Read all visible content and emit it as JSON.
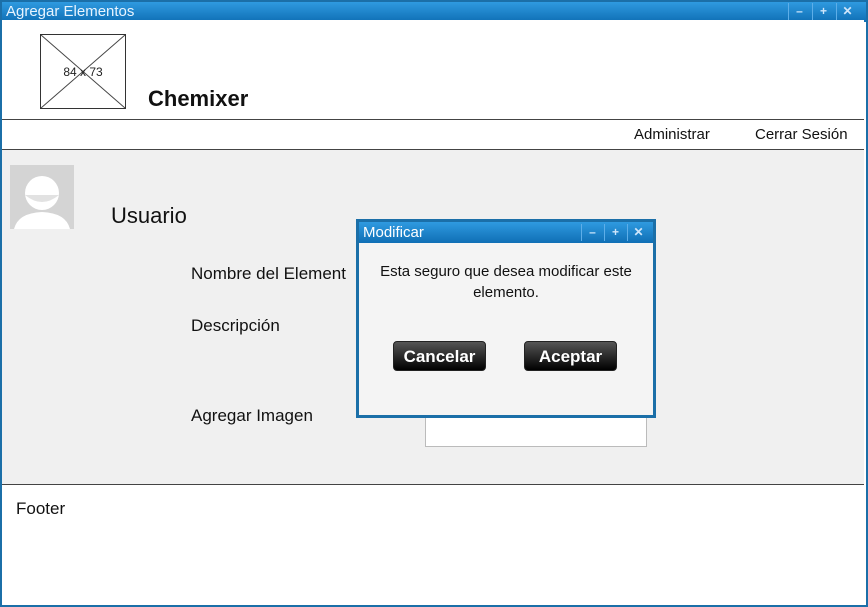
{
  "window": {
    "title": "Agregar Elementos",
    "controls": [
      "–",
      "+",
      "✕"
    ]
  },
  "header": {
    "logo_placeholder": "84 x 73",
    "brand": "Chemixer"
  },
  "nav": {
    "admin": "Administrar",
    "logout": "Cerrar Sesión"
  },
  "main": {
    "username": "Usuario",
    "labels": {
      "element_name": "Nombre del Element",
      "description": "Descripción",
      "add_image": "Agregar Imagen"
    }
  },
  "footer": {
    "text": "Footer"
  },
  "dialog": {
    "title": "Modificar",
    "controls": [
      "–",
      "+",
      "✕"
    ],
    "message": "Esta seguro que desea modificar este elemento.",
    "cancel": "Cancelar",
    "accept": "Aceptar"
  },
  "colors": {
    "titlebar": "#1b6fa8",
    "content_bg": "#f0f0f0",
    "button": "#000000"
  }
}
